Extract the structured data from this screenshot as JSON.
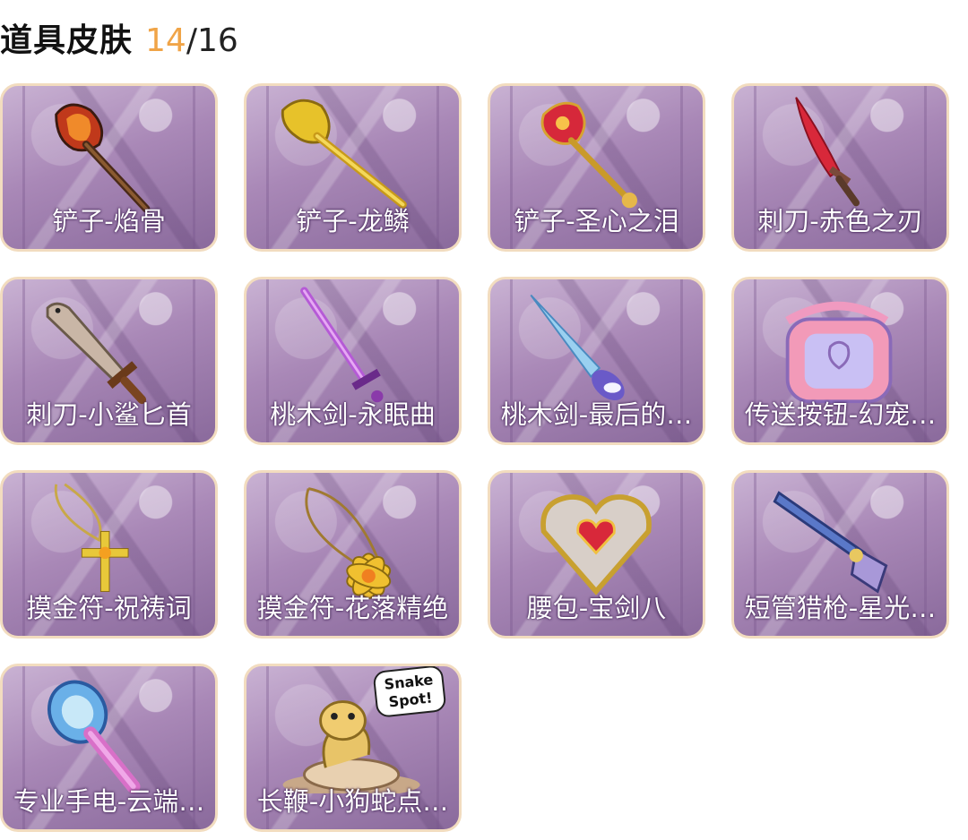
{
  "header": {
    "title": "道具皮肤",
    "owned": "14",
    "separator": "/",
    "total": "16"
  },
  "accent_color": "#f0a447",
  "items": [
    {
      "label": "铲子-焰骨",
      "icon": "shovel-icon"
    },
    {
      "label": "铲子-龙鳞",
      "icon": "shovel-icon"
    },
    {
      "label": "铲子-圣心之泪",
      "icon": "shovel-icon"
    },
    {
      "label": "刺刀-赤色之刃",
      "icon": "dagger-icon"
    },
    {
      "label": "刺刀-小鲨匕首",
      "icon": "dagger-icon"
    },
    {
      "label": "桃木剑-永眠曲",
      "icon": "sword-icon"
    },
    {
      "label": "桃木剑-最后的…",
      "icon": "sword-icon"
    },
    {
      "label": "传送按钮-幻宠…",
      "icon": "teleport-button-icon"
    },
    {
      "label": "摸金符-祝祷词",
      "icon": "amulet-icon"
    },
    {
      "label": "摸金符-花落精绝",
      "icon": "amulet-icon"
    },
    {
      "label": "腰包-宝剑八",
      "icon": "pouch-icon"
    },
    {
      "label": "短管猎枪-星光…",
      "icon": "shotgun-icon"
    },
    {
      "label": "专业手电-云端…",
      "icon": "flashlight-icon"
    },
    {
      "label": "长鞭-小狗蛇点…",
      "icon": "whip-icon",
      "sticker": "Snake Spot!"
    }
  ]
}
